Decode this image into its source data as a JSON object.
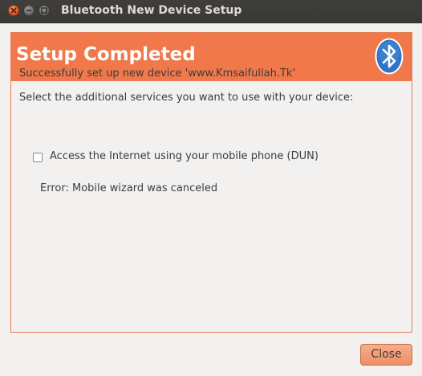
{
  "window": {
    "title": "Bluetooth New Device Setup"
  },
  "page": {
    "title": "Setup Completed",
    "success_text": "Successfully set up new device 'www.Kmsaifullah.Tk'",
    "services_prompt": "Select the additional services you want to use with your device:",
    "dun_option": {
      "label": "Access the Internet using your mobile phone (DUN)",
      "checked": false
    },
    "error_text": "Error: Mobile wizard was canceled"
  },
  "buttons": {
    "close_label": "Close"
  },
  "colors": {
    "accent": "#f0784a",
    "bluetooth_blue": "#2f74c4"
  },
  "icons": {
    "header": "bluetooth-icon"
  }
}
